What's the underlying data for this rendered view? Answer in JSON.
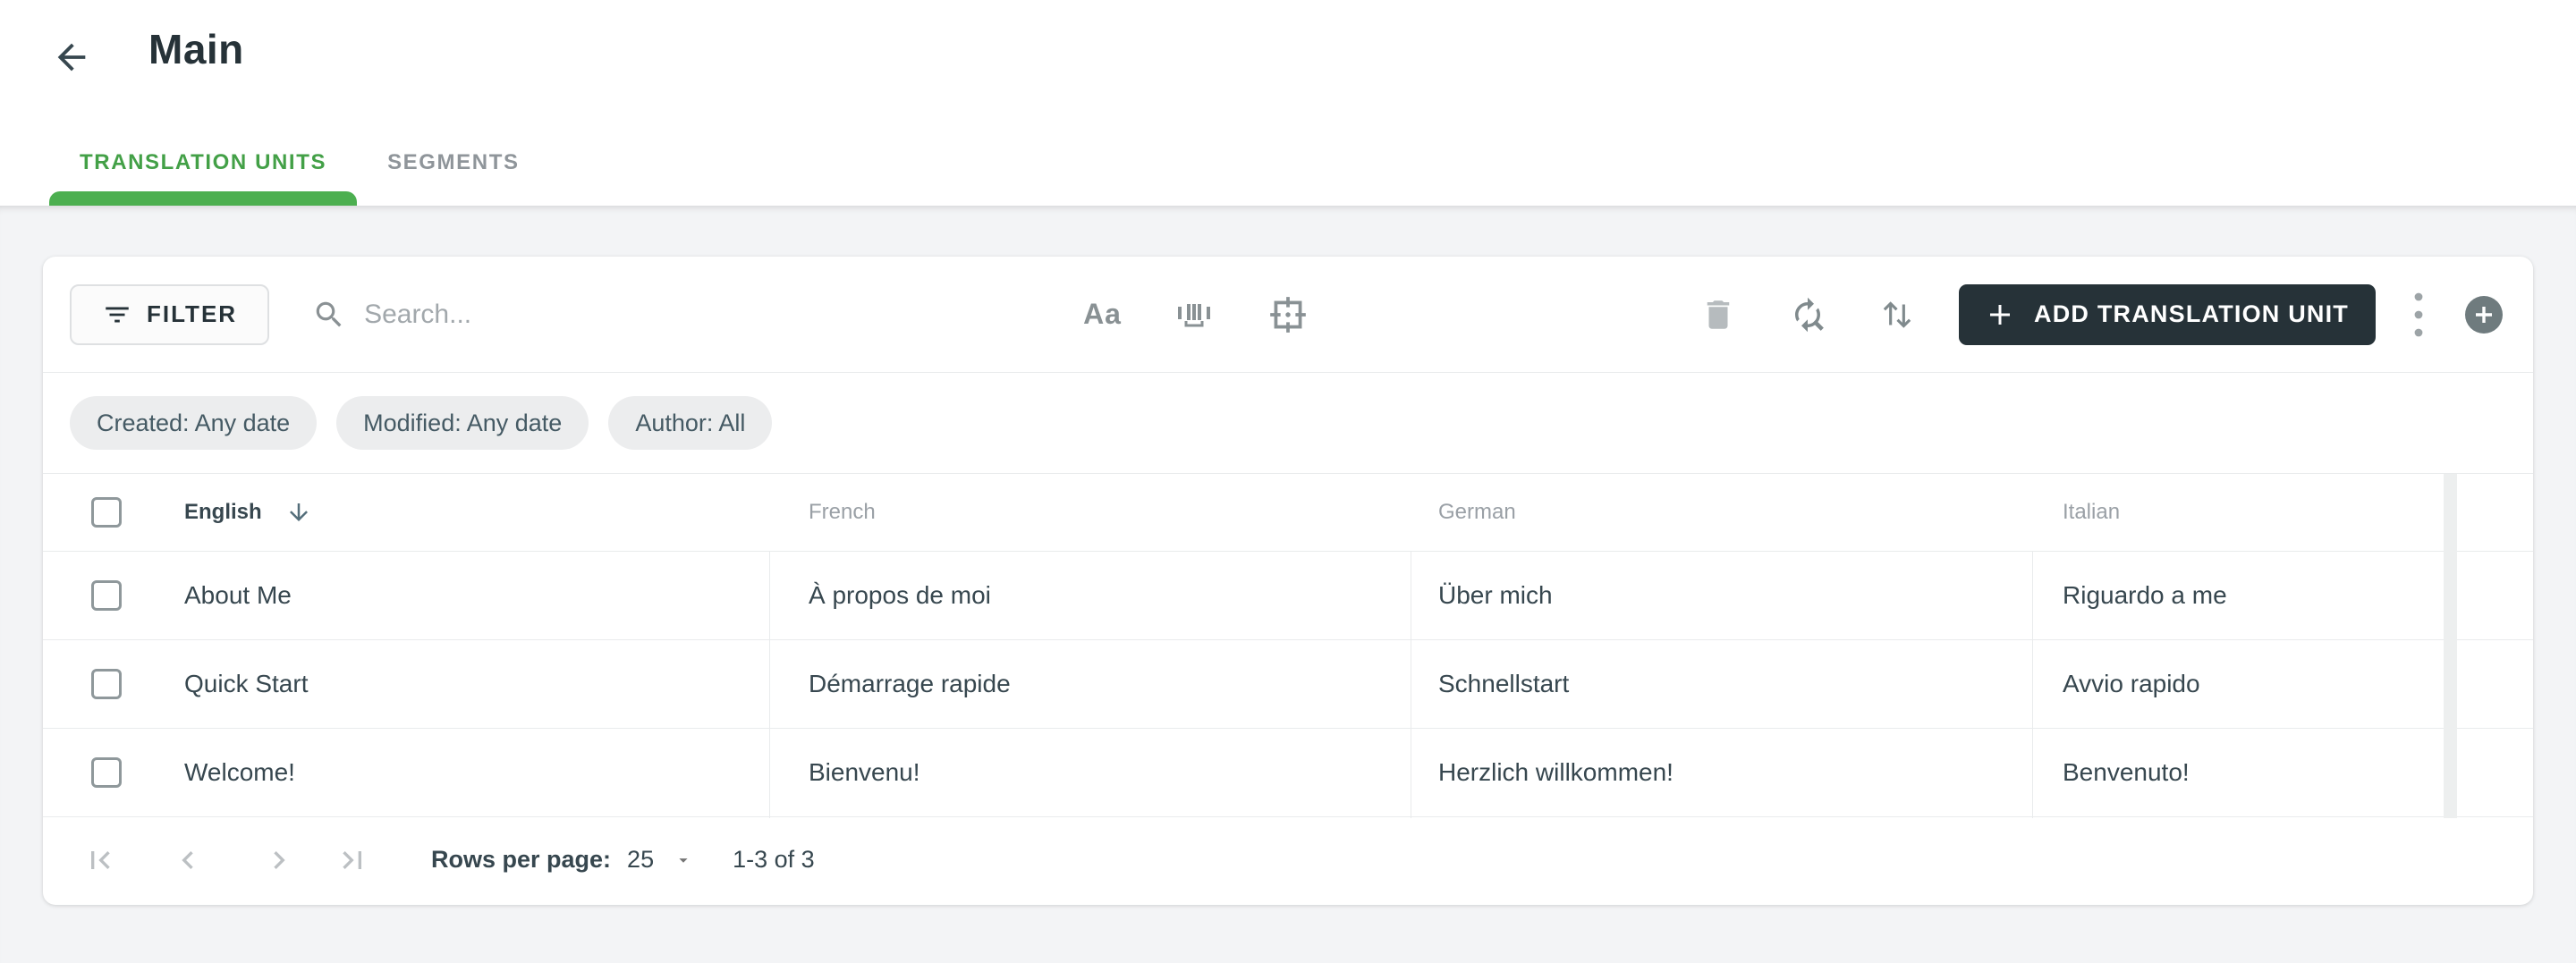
{
  "header": {
    "title": "Main"
  },
  "tabs": [
    {
      "label": "TRANSLATION UNITS",
      "active": true
    },
    {
      "label": "SEGMENTS",
      "active": false
    }
  ],
  "toolbar": {
    "filter_label": "FILTER",
    "search_placeholder": "Search...",
    "search_value": "",
    "match_case_label": "Aa",
    "add_button_label": "ADD TRANSLATION UNIT"
  },
  "chips": [
    {
      "label": "Created: Any date"
    },
    {
      "label": "Modified: Any date"
    },
    {
      "label": "Author: All"
    }
  ],
  "table": {
    "columns": [
      {
        "label": "English",
        "sorted": "desc"
      },
      {
        "label": "French"
      },
      {
        "label": "German"
      },
      {
        "label": "Italian"
      }
    ],
    "rows": [
      {
        "english": "About Me",
        "french": "À propos de moi",
        "german": "Über mich",
        "italian": "Riguardo a me"
      },
      {
        "english": "Quick Start",
        "french": "Démarrage rapide",
        "german": "Schnellstart",
        "italian": "Avvio rapido"
      },
      {
        "english": "Welcome!",
        "french": "Bienvenu!",
        "german": "Herzlich willkommen!",
        "italian": "Benvenuto!"
      }
    ]
  },
  "pagination": {
    "rows_per_page_label": "Rows per page:",
    "rows_per_page_value": "25",
    "range_label": "1-3 of 3"
  },
  "icons": {
    "back": "arrow-left",
    "filter": "filter-lines",
    "search": "magnifier",
    "match_case": "Aa",
    "whole_word": "barcode-brackets",
    "regex": "frame-crosshair-dot",
    "delete": "trash",
    "find_replace": "circular-arrows-magnifier",
    "sort": "up-down-arrows",
    "add": "plus",
    "more": "kebab-vertical-dots",
    "quick_add": "plus-circle",
    "sorted_column": "arrow-down",
    "pager": [
      "first-page",
      "prev-page",
      "next-page",
      "last-page"
    ],
    "rows_per_page_caret": "triangle-down"
  },
  "colors": {
    "accent": "#43A047",
    "accent-bar": "#4CAF50",
    "dark": "#263238",
    "text": "#37474F",
    "muted": "#9AA0A6",
    "icon": "#848C90",
    "icon-light": "#B6BBBE",
    "line": "#E9EBEC",
    "page-bg": "#F3F4F6",
    "chip-bg": "#ECEDEE",
    "button-bg": "#263238",
    "plus-bg": "#6F7B7E",
    "pager-icon": "#BCC0C3"
  }
}
